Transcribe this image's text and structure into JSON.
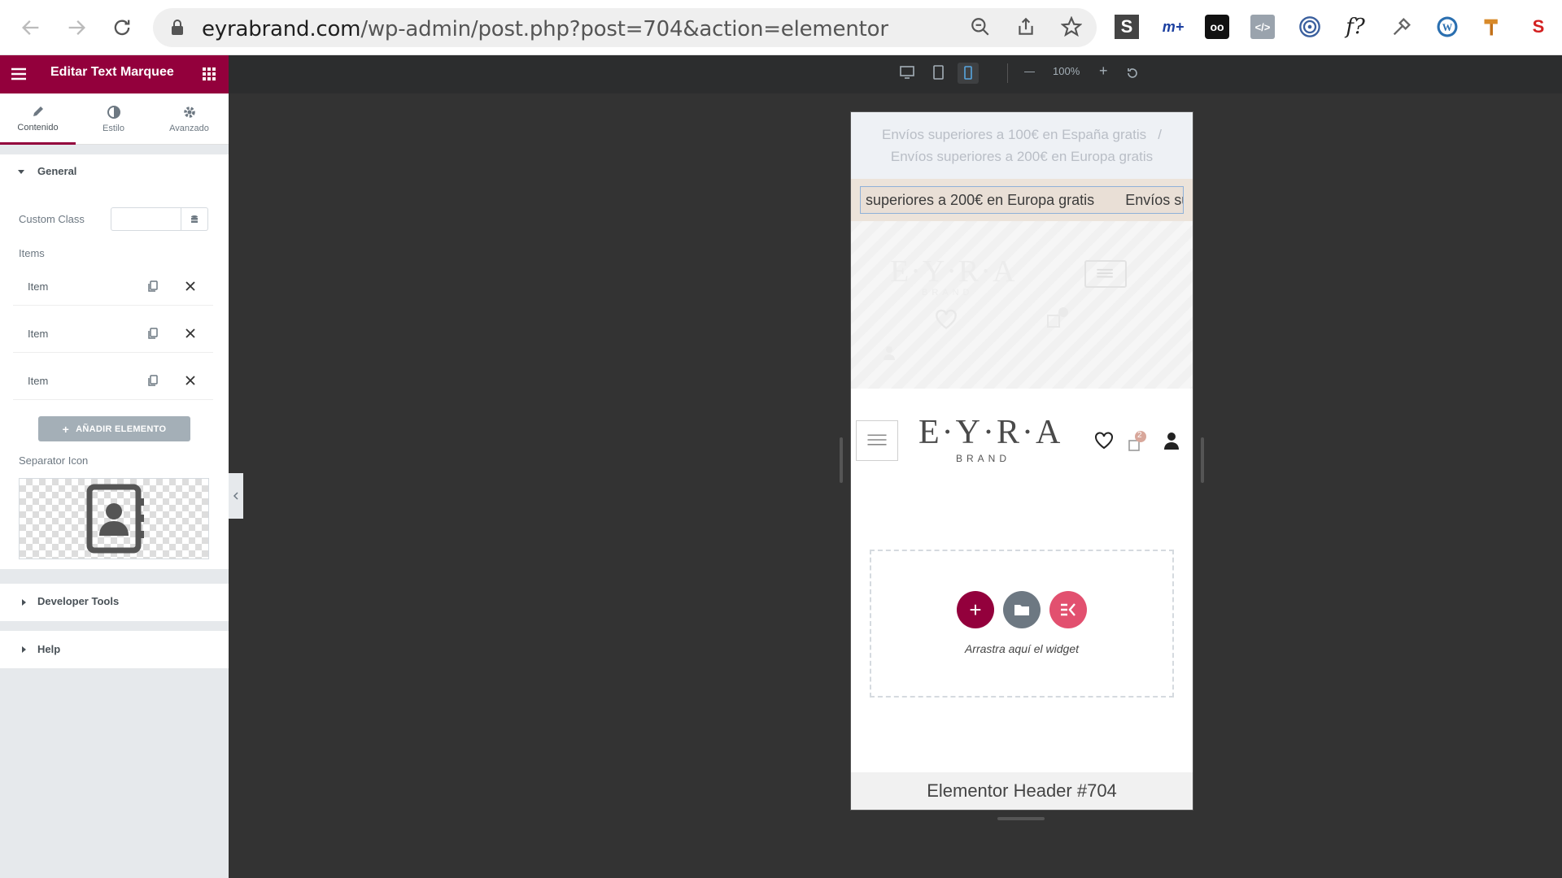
{
  "browser": {
    "url_domain": "eyrabrand.com",
    "url_path": "/wp-admin/post.php?post=704&action=elementor",
    "icons": [
      "back-icon",
      "forward-icon",
      "reload-icon",
      "lock-icon",
      "zoom-icon",
      "share-icon",
      "star-icon"
    ],
    "extensions": [
      "S",
      "oo",
      "f?"
    ]
  },
  "panel": {
    "title": "Editar Text Marquee",
    "tabs": [
      {
        "label": "Contenido"
      },
      {
        "label": "Estilo"
      },
      {
        "label": "Avanzado"
      }
    ],
    "general": {
      "title": "General",
      "custom_class_label": "Custom Class",
      "custom_class_value": "",
      "items_label": "Items",
      "items": [
        {
          "label": "Item"
        },
        {
          "label": "Item"
        },
        {
          "label": "Item"
        }
      ],
      "add_button": "AÑADIR ELEMENTO",
      "separator_label": "Separator Icon"
    },
    "developer_tools": "Developer Tools",
    "help": "Help"
  },
  "toolbar": {
    "zoom": "100%"
  },
  "preview": {
    "announce_line1": "Envíos superiores a 100€ en España gratis",
    "announce_sep": "/",
    "announce_line2": "Envíos superiores a 200€ en Europa gratis",
    "marquee_text": "superiores a 200€ en Europa gratis",
    "marquee_text2": "Envíos supe",
    "logo": "E·Y·R·A",
    "logo_sub": "BRAND",
    "cart_count": "2",
    "dropzone_text": "Arrastra aquí el widget",
    "footer_title": "Elementor Header #704"
  },
  "colors": {
    "brand": "#93003c",
    "accent": "#e2506f",
    "button_grey": "#a4afb7"
  }
}
